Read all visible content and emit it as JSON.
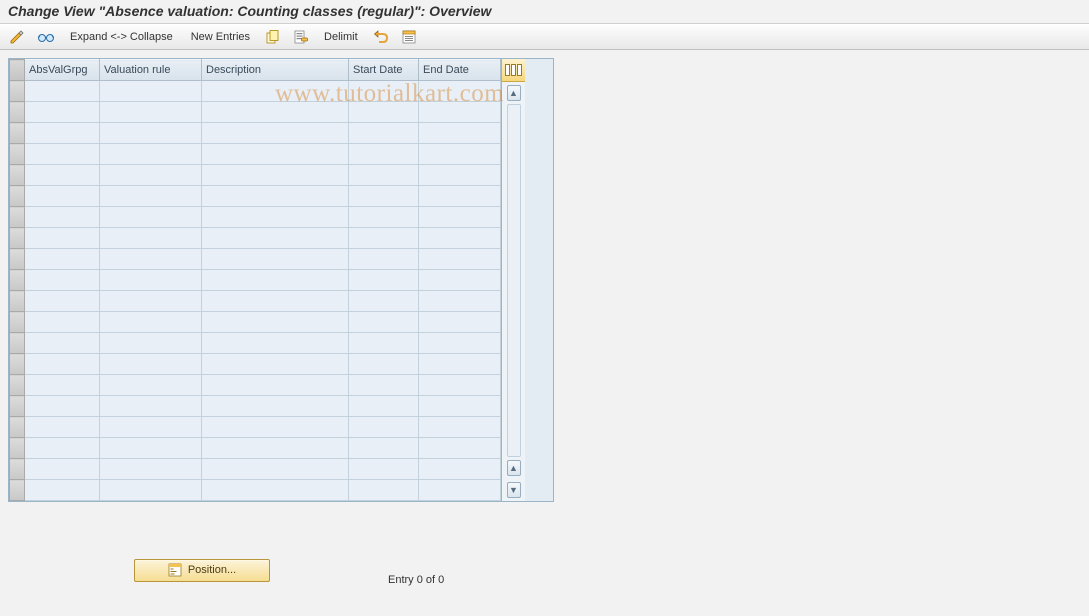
{
  "title": "Change View \"Absence valuation: Counting classes (regular)\": Overview",
  "toolbar": {
    "expand_collapse": "Expand <-> Collapse",
    "new_entries": "New Entries",
    "delimit": "Delimit"
  },
  "table": {
    "columns": {
      "absvalgrpg": "AbsValGrpg",
      "valuation_rule": "Valuation rule",
      "description": "Description",
      "start_date": "Start Date",
      "end_date": "End Date"
    },
    "row_count": 20
  },
  "footer": {
    "position_button": "Position...",
    "entry_status": "Entry 0 of 0"
  },
  "watermark": "www.tutorialkart.com"
}
